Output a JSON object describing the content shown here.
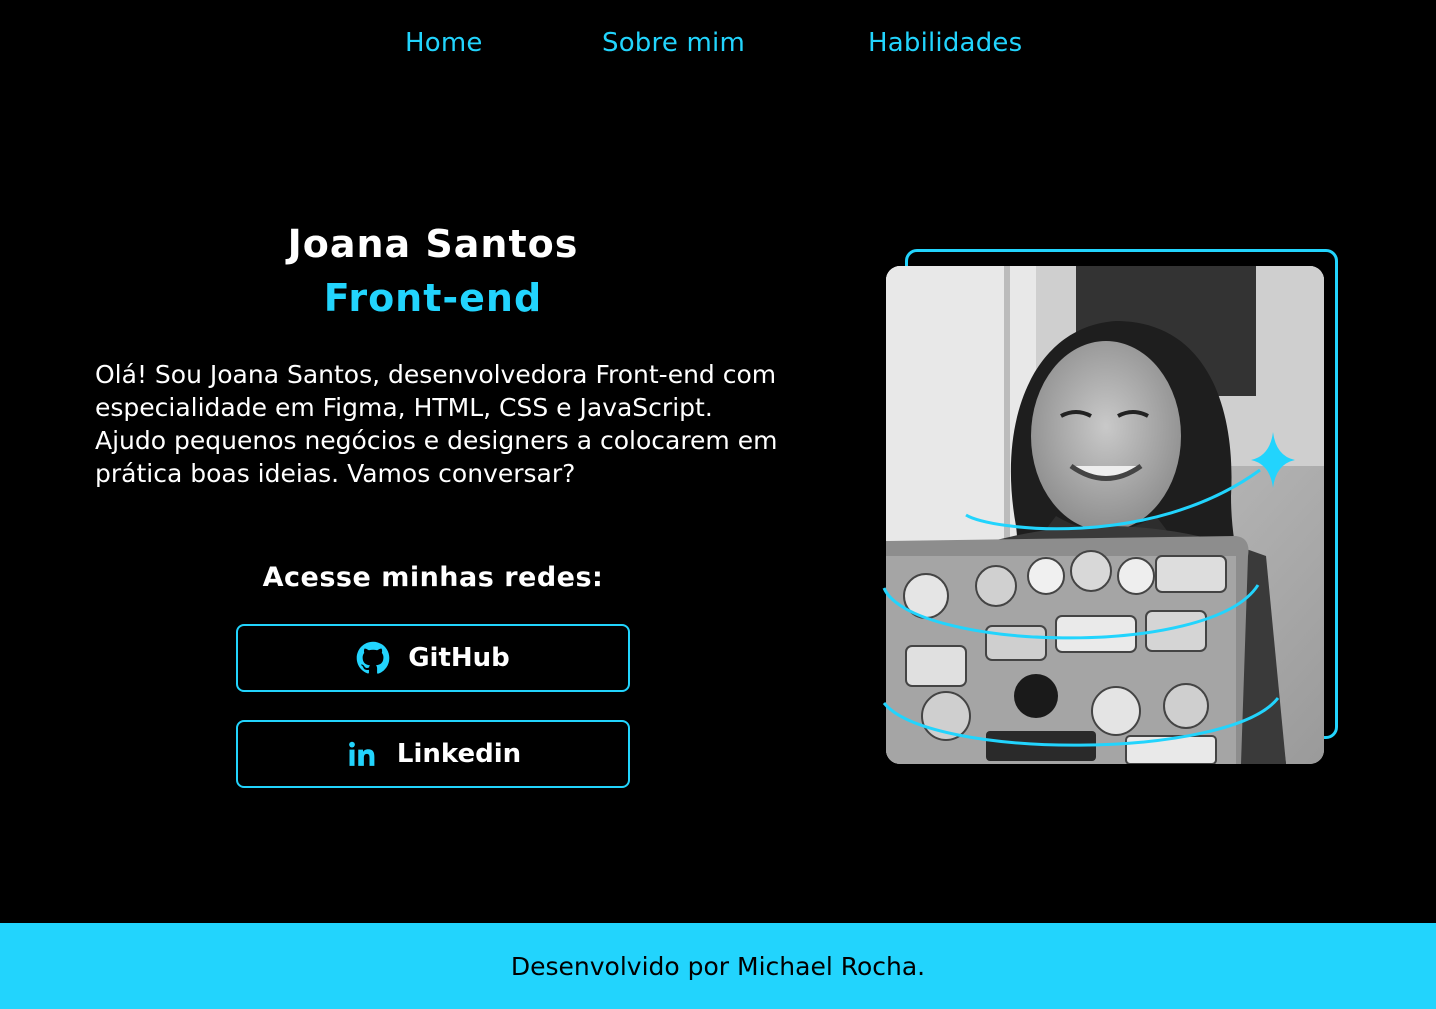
{
  "nav": {
    "items": [
      {
        "label": "Home"
      },
      {
        "label": "Sobre mim"
      },
      {
        "label": "Habilidades"
      }
    ]
  },
  "hero": {
    "name": "Joana Santos",
    "role": "Front-end",
    "bio": "Olá! Sou Joana Santos, desenvolvedora Front-end com especialidade em Figma, HTML, CSS e JavaScript. Ajudo pequenos negócios e designers a colocarem em prática boas ideias. Vamos conversar?",
    "social_title": "Acesse minhas redes:",
    "social": {
      "github": {
        "label": "GitHub",
        "icon": "github-icon"
      },
      "linkedin": {
        "label": "Linkedin",
        "icon": "linkedin-icon"
      }
    }
  },
  "footer": {
    "text": "Desenvolvido por Michael Rocha."
  },
  "colors": {
    "accent": "#22d4fd",
    "background": "#000000",
    "text": "#ffffff"
  }
}
